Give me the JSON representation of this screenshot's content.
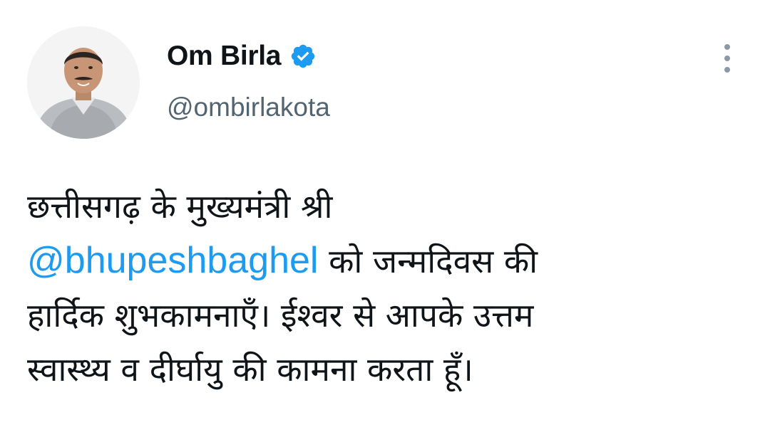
{
  "author": {
    "display_name": "Om Birla",
    "handle": "@ombirlakota",
    "verified": true,
    "avatar_icon": "profile-photo"
  },
  "menu": {
    "icon": "more-vertical-icon"
  },
  "tweet": {
    "line1": "छत्तीसगढ़ के मुख्यमंत्री श्री",
    "mention": "@bhupeshbaghel",
    "line2_rest": " को जन्मदिवस की",
    "line3": "हार्दिक शुभकामनाएँ। ईश्वर से आपके उत्तम",
    "line4": "स्वास्थ्य व दीर्घायु की कामना करता हूँ।"
  },
  "colors": {
    "link": "#1d9bf0",
    "verified_badge": "#1d9bf0",
    "secondary_text": "#536471",
    "primary_text": "#0f1419"
  }
}
